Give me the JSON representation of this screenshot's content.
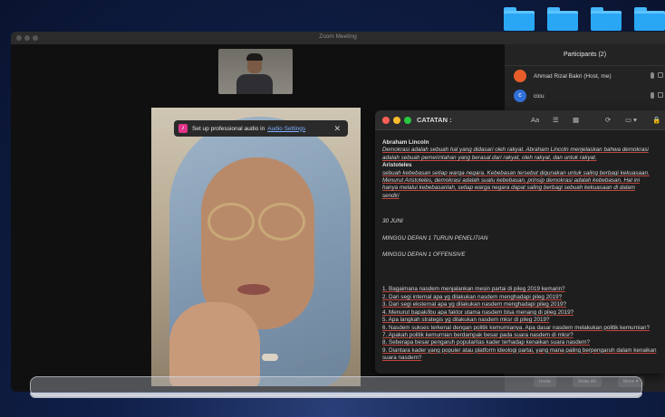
{
  "zoom": {
    "title": "Zoom Meeting",
    "audio_notice": {
      "text": "Set up professional audio in",
      "link": "Audio Settings",
      "close": "✕"
    },
    "participants": {
      "header": "Participants (2)",
      "items": [
        {
          "initial": "",
          "name": "Ahmad Rizal Bakri (Host, me)",
          "color": "#e85d2a"
        },
        {
          "initial": "c",
          "name": "cicu",
          "color": "#2f6fd6"
        }
      ],
      "footer": [
        "Invite",
        "Mute All",
        "More ▾"
      ]
    }
  },
  "notes": {
    "title": "CATATAN :",
    "toolbar": [
      "Aa",
      "☰",
      "▦",
      "⟳",
      "▭ ▾",
      "🔒"
    ],
    "content": {
      "heading1": "Abraham Lincoln",
      "line1": "Demokrasi adalah sebuah hal yang didasari oleh rakyat. Abraham Lincoln menjelaskan bahwa demokrasi",
      "line2": "adalah sebuah pemerintahan yang berasal dari rakyat, oleh rakyat, dan untuk rakyat.",
      "heading2": "Aristoteles",
      "line3": "sebuah kebebasan setiap warga negara. Kebebasan tersebut digunakan untuk saling berbagi kekuasaan.",
      "line4": "Menurut Aristoteles, demokrasi adalah suatu kebebasan, prinsip demokrasi adalah kebebasan. Hal ini",
      "line5": "hanya melalui kebebasanlah, setiap warga negara dapat saling berbagi sebuah kekuasaan di dalam",
      "line6": "sendiri",
      "date": "30 JUNI",
      "week1": "MINGGU DEPAN 1 TURUN PENELITIAN",
      "week2": "MINGGU DEPAN 1 OFFENSIVE",
      "questions": [
        "1. Bagaimana nasdem menjalankan mesin partai di pileg 2019 kemarin?",
        "2. Dari segi internal apa yg dilakukan nasdem menghadapi pileg 2019?",
        "3. Dari segi eksternal apa yg dilakukan nasdem menghadapi pileg 2019?",
        "4. Menurut bapak/ibu apa faktor utama nasdem bisa menang di pileg 2019?",
        "5. Apa langkah strategis yg dilakukan nasdem mksr di pileg 2019?",
        "6. Nasdem sukses terkenal dengan politik kemurnianya. Apa dasar nasdem melakukan politik kemurnian?",
        "7. Apakah politik kemurnian berdampak besar pada suara nasdem di mksr?",
        "8. Seberapa besar pengaruh popularitas kader terhadap kenaikan suara nasdem?",
        "9. Diantara kader yang populer atau platform ideologi partai, yang mana paling berpengaruh dalam kenaikan",
        "suara nasdem?"
      ]
    }
  }
}
